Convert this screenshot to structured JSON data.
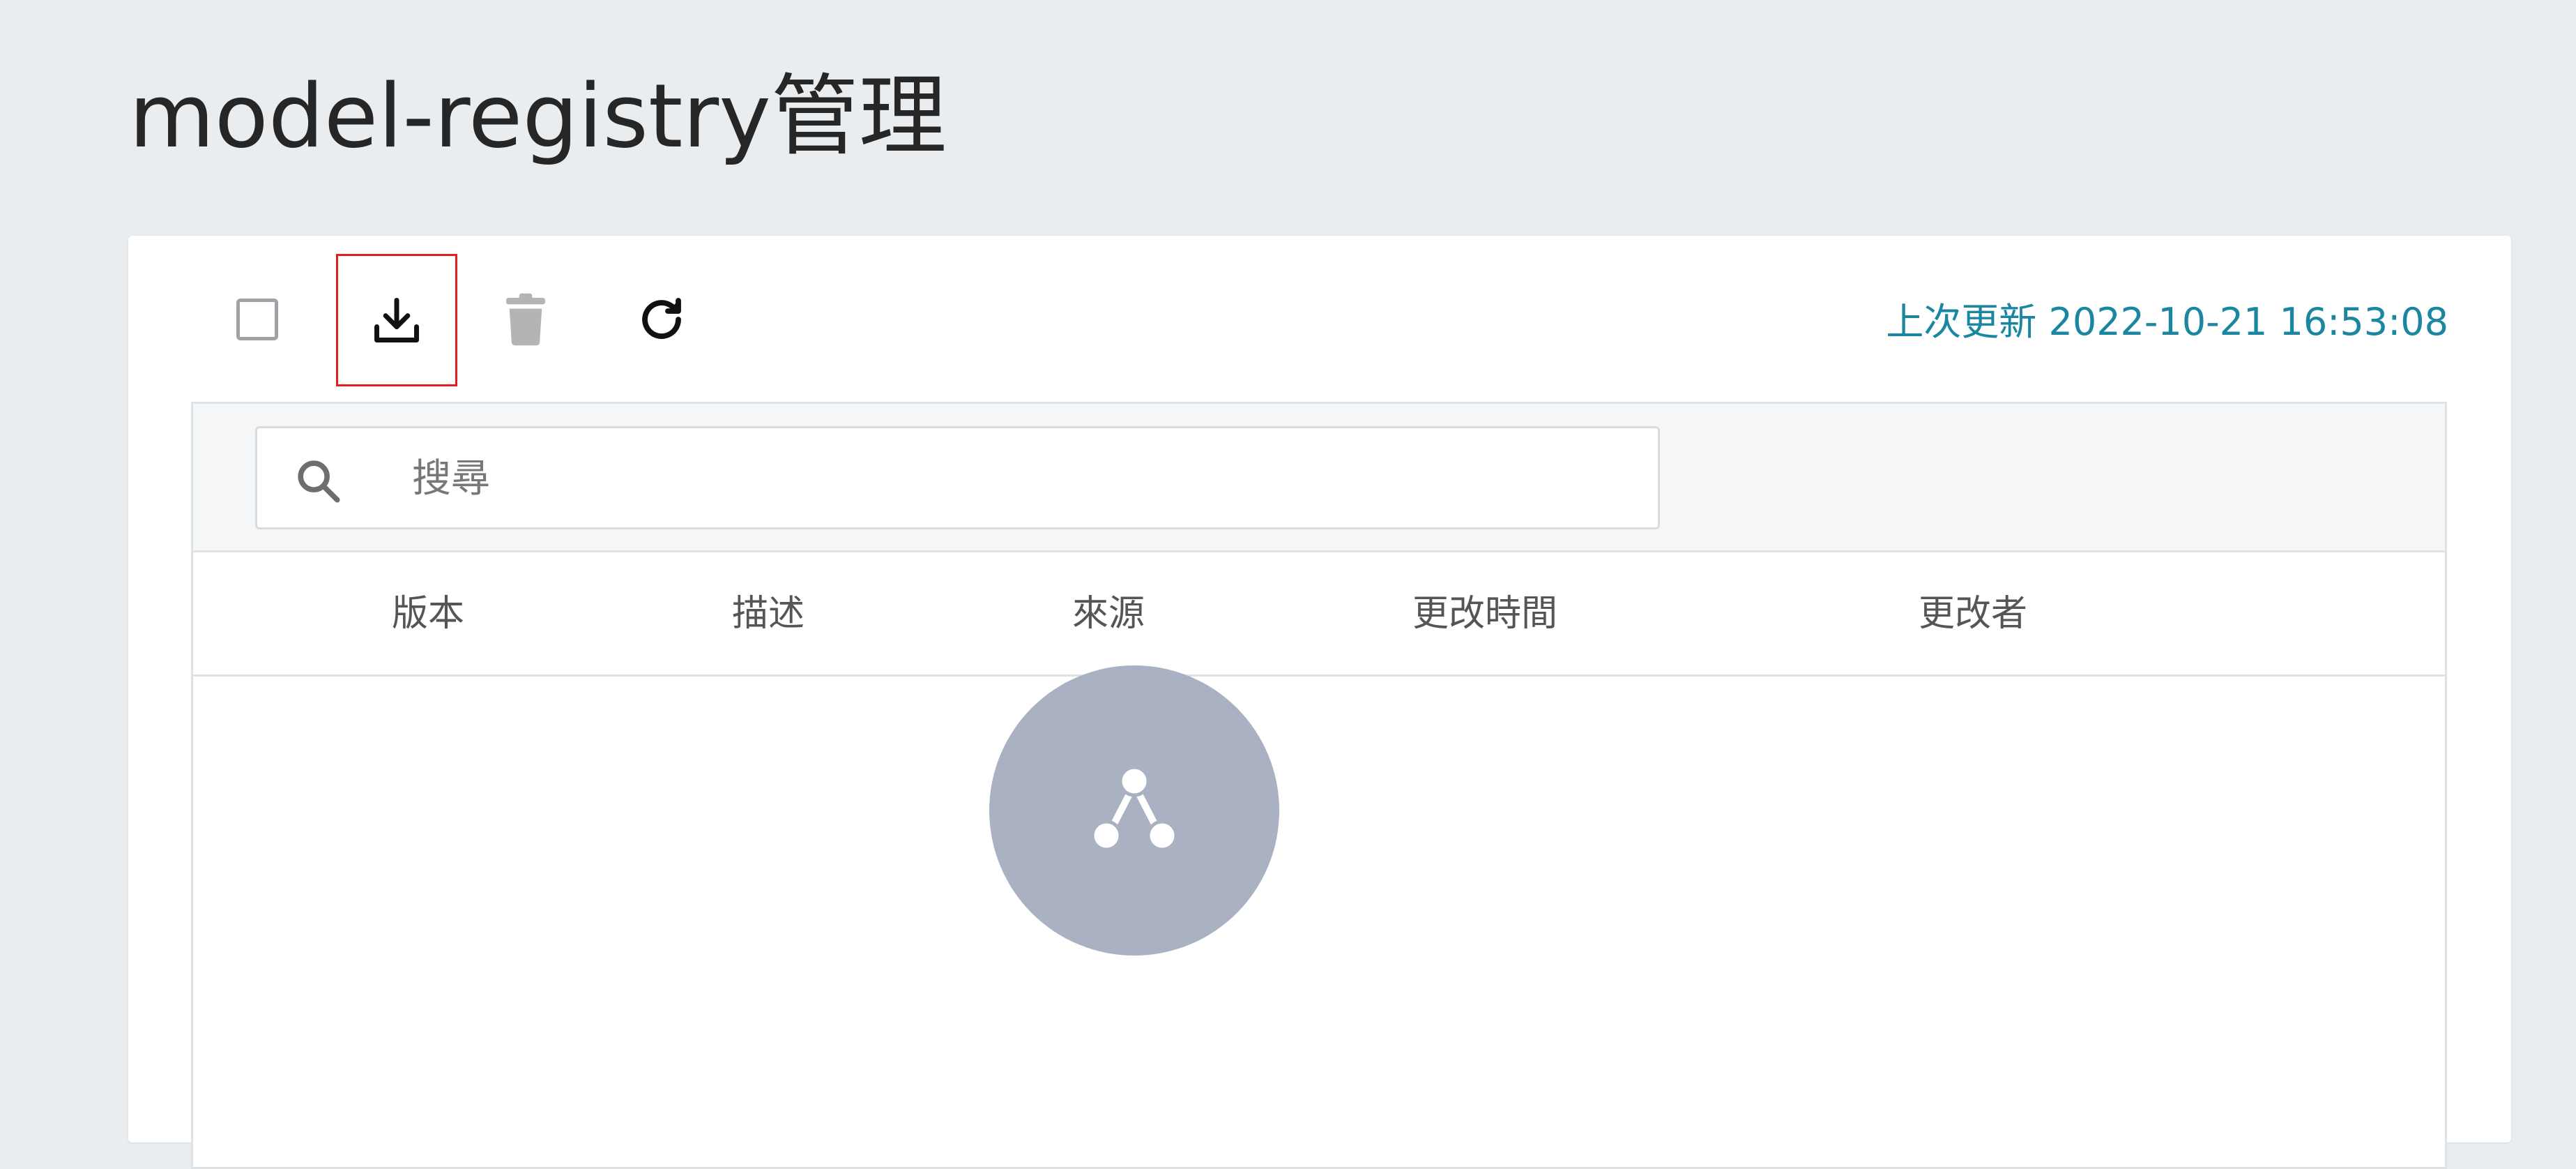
{
  "page": {
    "title": "model-registry管理"
  },
  "toolbar": {
    "select_all": "select-all-checkbox",
    "download_icon": "download-icon",
    "delete_icon": "trash-icon",
    "refresh_icon": "refresh-icon",
    "last_updated": "上次更新 2022-10-21 16:53:08"
  },
  "search": {
    "placeholder": "搜尋",
    "value": ""
  },
  "table": {
    "columns": [
      "版本",
      "描述",
      "來源",
      "更改時間",
      "更改者"
    ],
    "rows": []
  },
  "empty_state": {
    "icon": "empty-nodes-icon"
  },
  "colors": {
    "background": "#e9edf0",
    "accent": "#1a86a0",
    "highlight_border": "#e02020",
    "empty_circle": "#a9b1c2"
  }
}
